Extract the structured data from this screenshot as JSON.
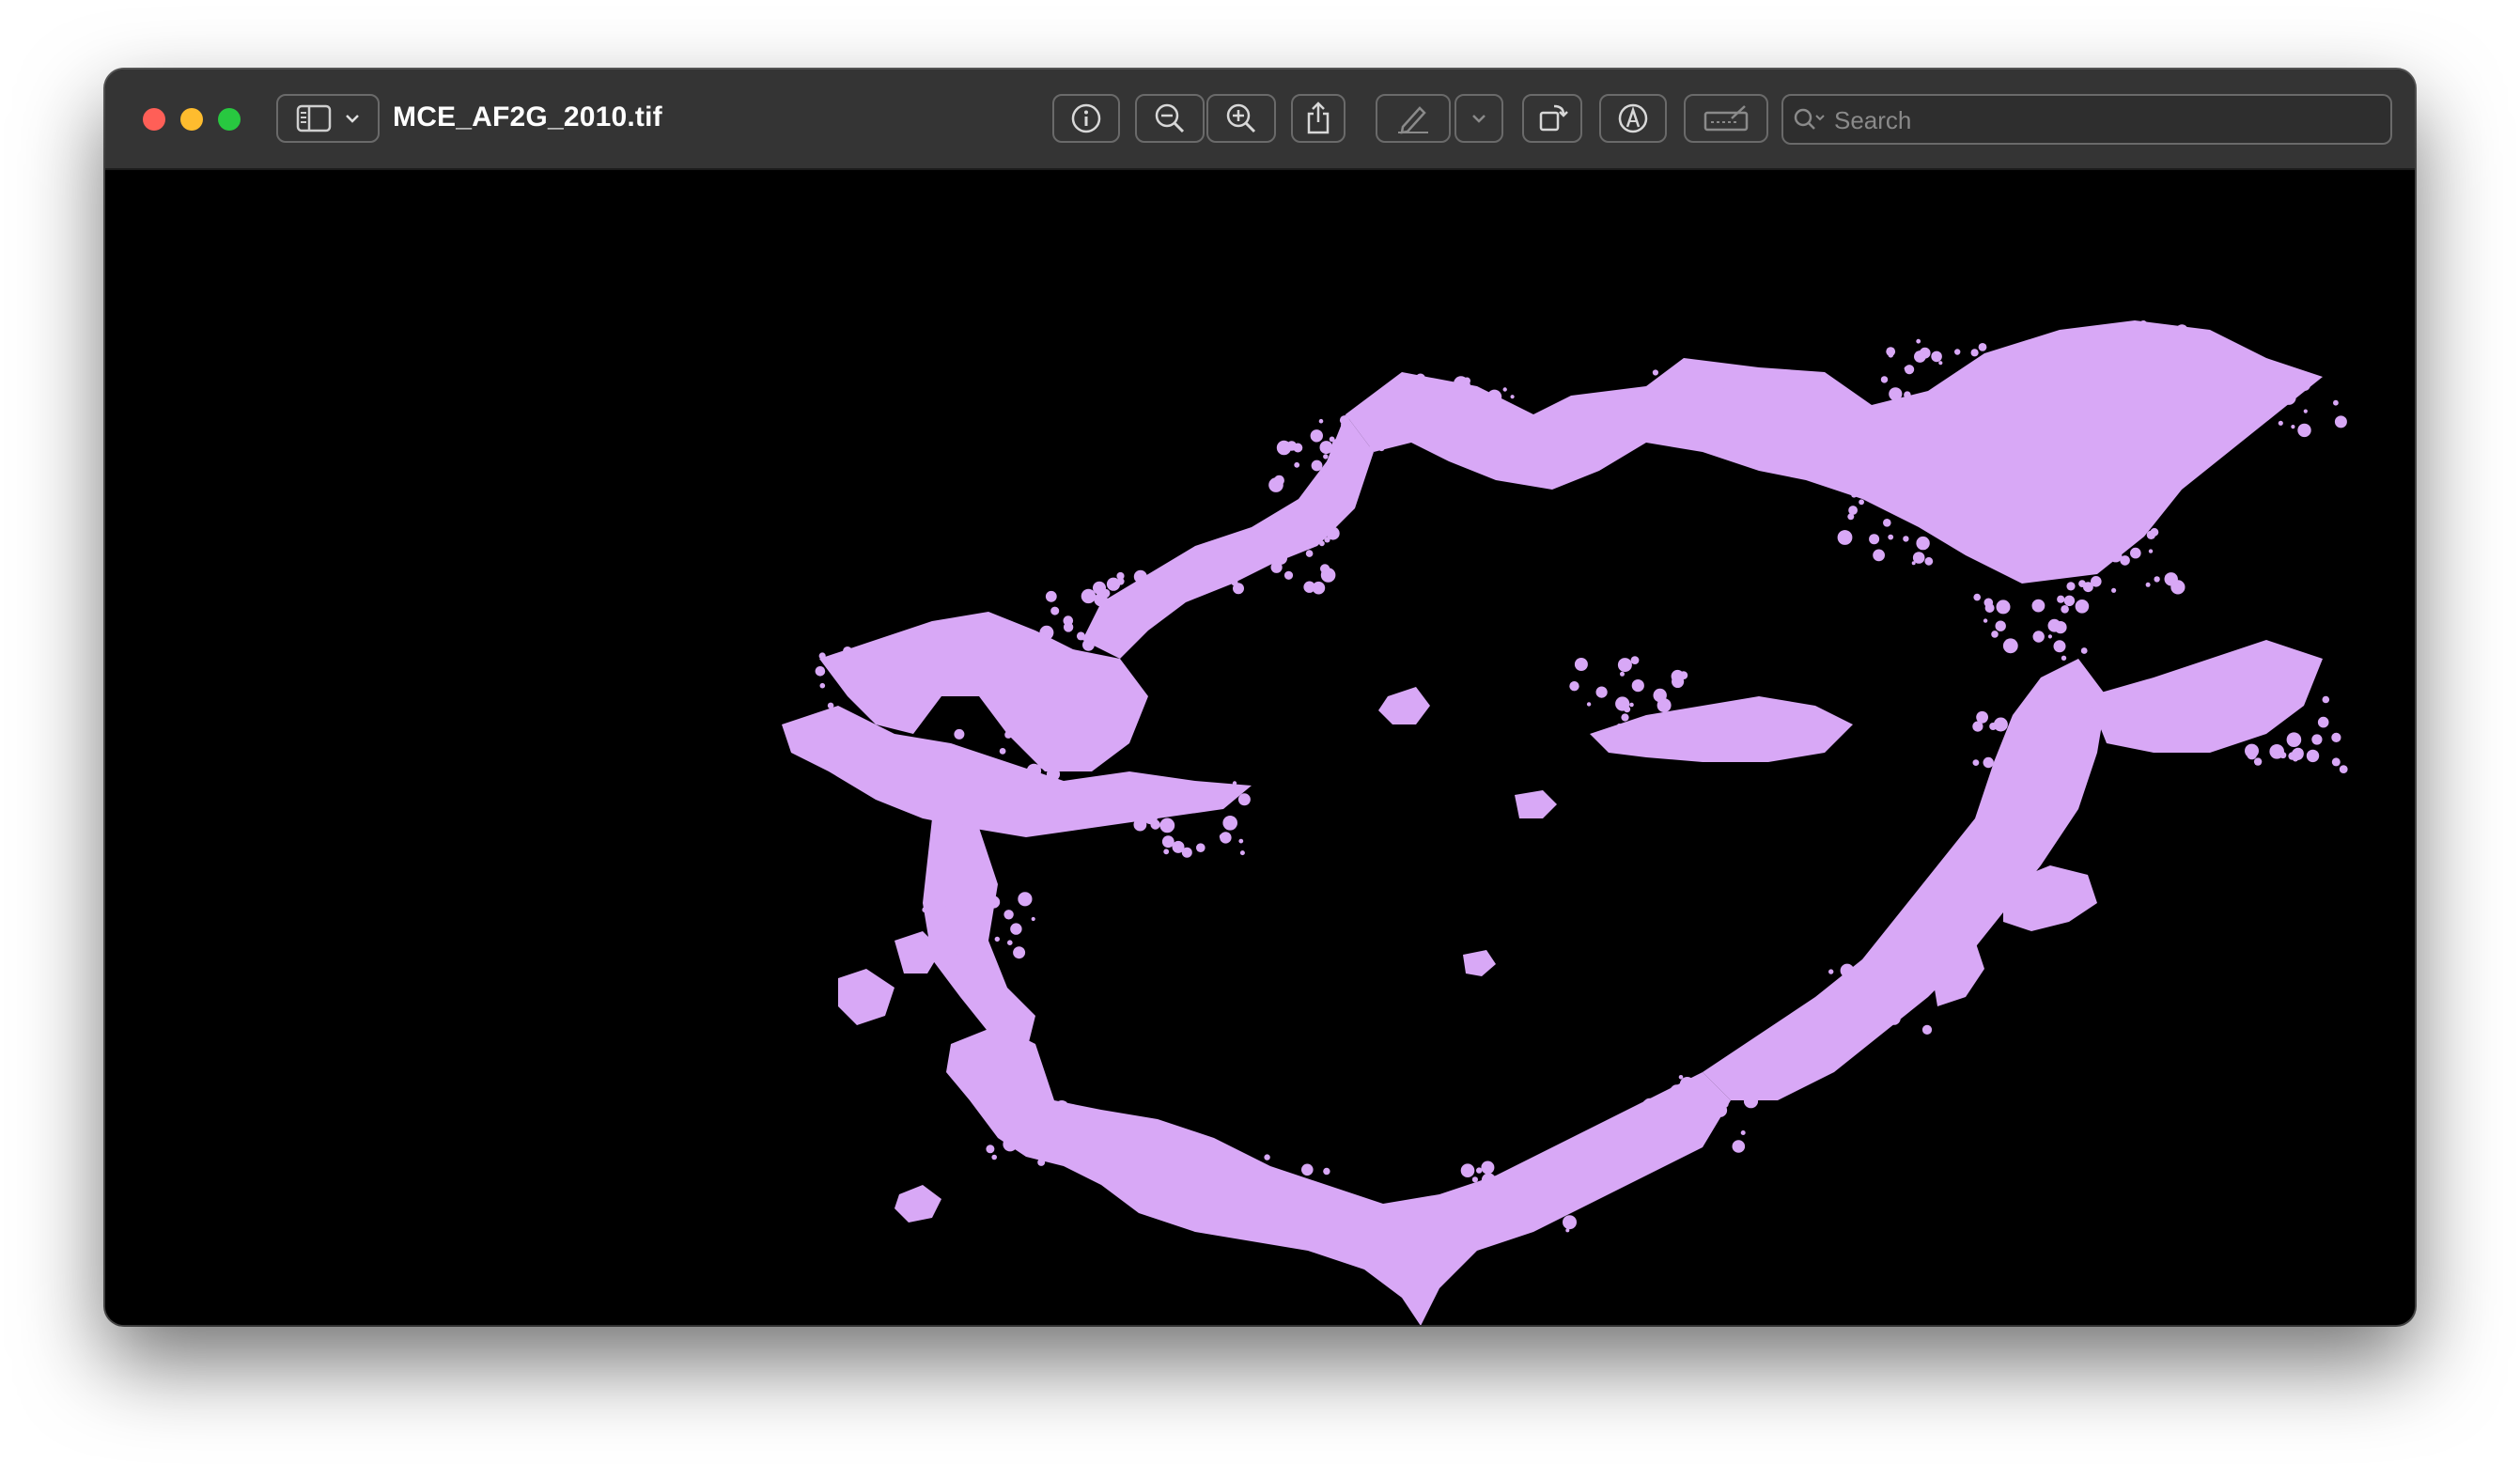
{
  "window": {
    "title": "MCE_AF2G_2010.tif"
  },
  "toolbar": {
    "buttons": [
      {
        "name": "sidebar-toggle",
        "icon": "sidebar-icon"
      },
      {
        "name": "info",
        "icon": "info-icon"
      },
      {
        "name": "zoom-out",
        "icon": "zoom-out-icon"
      },
      {
        "name": "zoom-in",
        "icon": "zoom-in-icon"
      },
      {
        "name": "share",
        "icon": "share-icon"
      },
      {
        "name": "markup",
        "icon": "pen-icon"
      },
      {
        "name": "markup-options",
        "icon": "chevron-down-icon"
      },
      {
        "name": "rotate",
        "icon": "rotate-icon"
      },
      {
        "name": "annotate",
        "icon": "markup-circle-icon"
      },
      {
        "name": "signature",
        "icon": "signature-icon"
      }
    ]
  },
  "search": {
    "placeholder": "Search",
    "value": ""
  },
  "image": {
    "mask_color": "#d8a8f6",
    "background_color": "#000000"
  }
}
